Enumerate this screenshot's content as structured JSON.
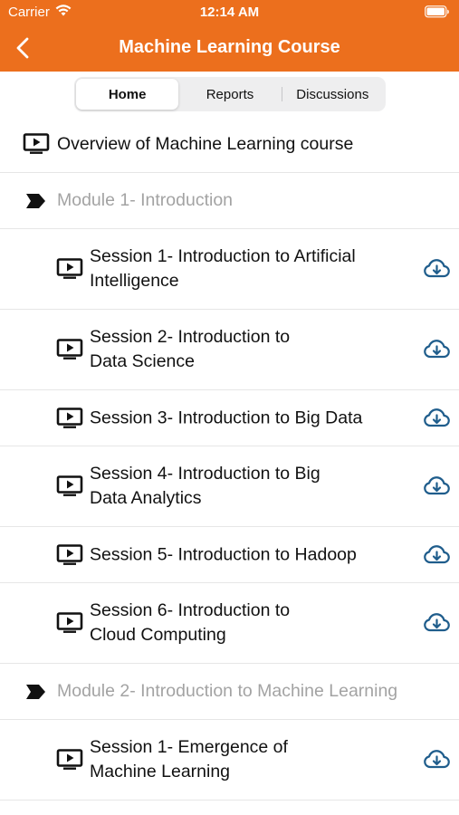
{
  "status_bar": {
    "carrier": "Carrier",
    "time": "12:14 AM"
  },
  "nav": {
    "title": "Machine Learning Course"
  },
  "tabs": [
    {
      "label": "Home",
      "active": true
    },
    {
      "label": "Reports",
      "active": false
    },
    {
      "label": "Discussions",
      "active": false
    }
  ],
  "overview": {
    "label": "Overview of Machine Learning course"
  },
  "modules": [
    {
      "title": "Module 1- Introduction",
      "sessions": [
        {
          "line1": "Session 1- Introduction to Artificial",
          "line2": "Intelligence"
        },
        {
          "line1": "Session 2- Introduction to",
          "line2": "Data Science"
        },
        {
          "line1": "Session 3- Introduction to Big Data",
          "line2": ""
        },
        {
          "line1": "Session 4- Introduction to Big",
          "line2": "Data Analytics"
        },
        {
          "line1": "Session 5- Introduction to Hadoop",
          "line2": ""
        },
        {
          "line1": "Session 6- Introduction to",
          "line2": "Cloud Computing"
        }
      ]
    },
    {
      "title": "Module 2- Introduction to Machine Learning",
      "sessions": [
        {
          "line1": "Session 1- Emergence of",
          "line2": "Machine Learning"
        }
      ]
    }
  ],
  "colors": {
    "brand": "#EC6F1D",
    "download_icon": "#1F5D8C",
    "module_text": "#A3A3A3"
  },
  "icons": {
    "video": "video-play-icon",
    "download": "cloud-download-icon",
    "module": "chevron-bullet-icon",
    "back": "back-chevron-icon"
  }
}
